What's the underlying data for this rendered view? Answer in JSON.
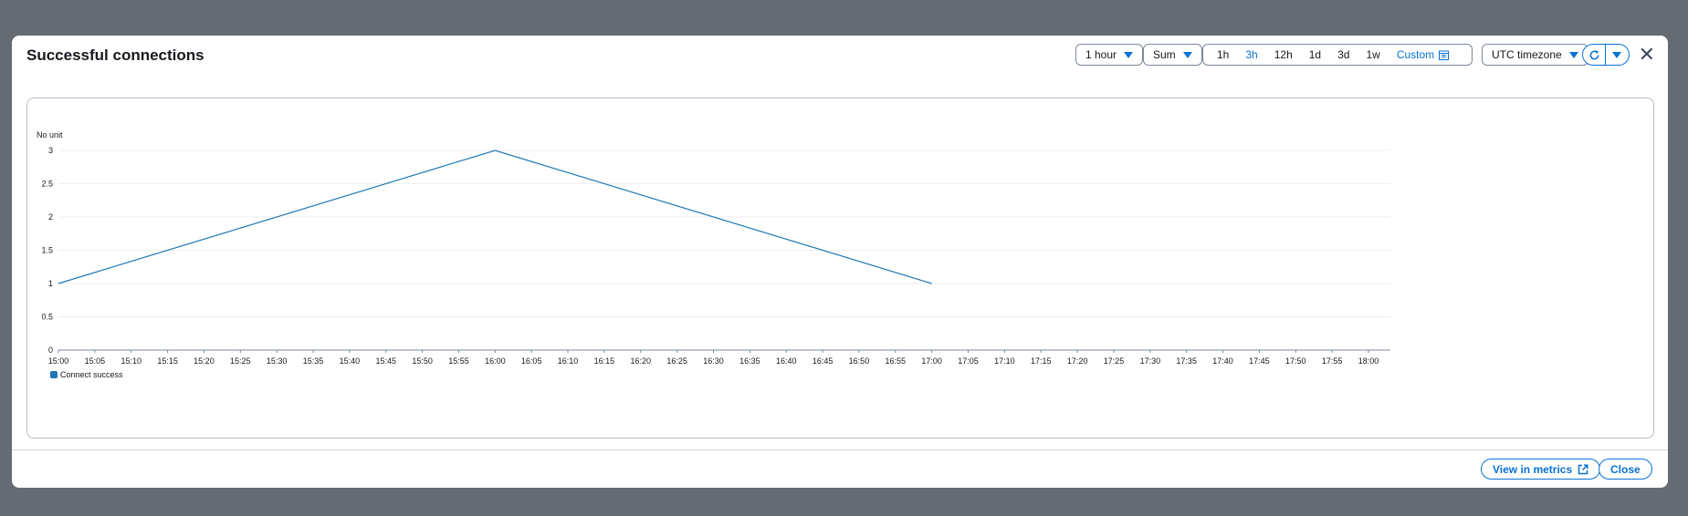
{
  "modal": {
    "title": "Successful connections",
    "period": "1 hour",
    "stat": "Sum",
    "ranges": [
      "1h",
      "3h",
      "12h",
      "1d",
      "3d",
      "1w"
    ],
    "active_range": "3h",
    "custom_label": "Custom",
    "timezone": "UTC timezone",
    "view_in_metrics": "View in metrics",
    "close": "Close"
  },
  "chart_data": {
    "type": "line",
    "unit_label": "No unit",
    "y_ticks": [
      "0",
      "0.5",
      "1",
      "1.5",
      "2",
      "2.5",
      "3"
    ],
    "ylim": [
      0,
      3
    ],
    "x_ticks": [
      "15:00",
      "15:05",
      "15:10",
      "15:15",
      "15:20",
      "15:25",
      "15:30",
      "15:35",
      "15:40",
      "15:45",
      "15:50",
      "15:55",
      "16:00",
      "16:05",
      "16:10",
      "16:15",
      "16:20",
      "16:25",
      "16:30",
      "16:35",
      "16:40",
      "16:45",
      "16:50",
      "16:55",
      "17:00",
      "17:05",
      "17:10",
      "17:15",
      "17:20",
      "17:25",
      "17:30",
      "17:35",
      "17:40",
      "17:45",
      "17:50",
      "17:55",
      "18:00"
    ],
    "series": [
      {
        "name": "Connect success",
        "color": "#1f77b4",
        "x": [
          "15:00",
          "16:00",
          "17:00"
        ],
        "y": [
          1,
          3,
          1
        ]
      }
    ],
    "grid": true,
    "legend": "bottom-left"
  }
}
